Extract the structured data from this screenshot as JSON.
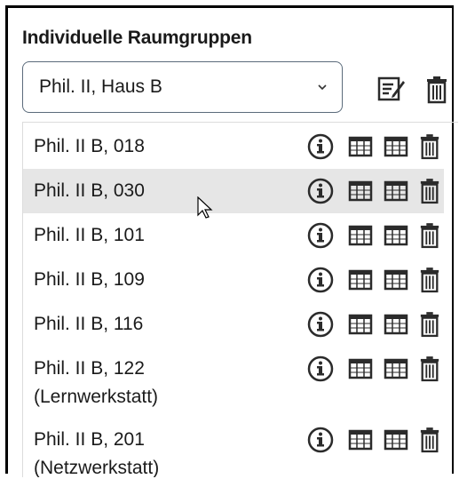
{
  "panel": {
    "title": "Individuelle Raumgruppen",
    "select_value": "Phil. II, Haus B"
  },
  "top_icons": [
    "edit-note-icon",
    "trash-icon"
  ],
  "row_icons": [
    "info-icon",
    "calendar-grid-icon",
    "calendar-grid-icon",
    "trash-icon"
  ],
  "rooms": [
    {
      "label": "Phil. II B, 018"
    },
    {
      "label": "Phil. II B, 030",
      "highlighted": true
    },
    {
      "label": "Phil. II B, 101"
    },
    {
      "label": "Phil. II B, 109"
    },
    {
      "label": "Phil. II B, 116"
    },
    {
      "label": "Phil. II B, 122\n(Lernwerkstatt)"
    },
    {
      "label": "Phil. II B, 201\n(Netzwerkstatt)"
    }
  ],
  "colors": {
    "highlight": "#e6e6e6",
    "icon": "#2b2b2b"
  }
}
